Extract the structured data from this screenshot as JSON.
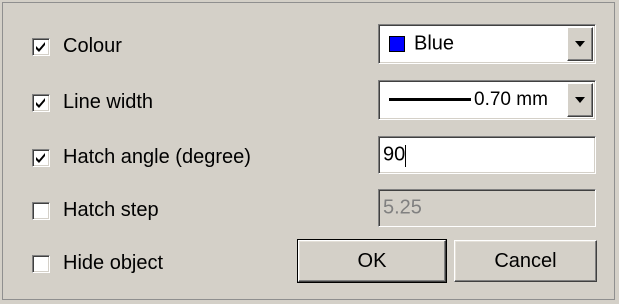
{
  "options": {
    "colour": {
      "label": "Colour",
      "checked": true
    },
    "line_width": {
      "label": "Line width",
      "checked": true
    },
    "hatch_angle": {
      "label": "Hatch angle (degree)",
      "checked": true
    },
    "hatch_step": {
      "label": "Hatch step",
      "checked": false
    },
    "hide_object": {
      "label": "Hide object",
      "checked": false
    }
  },
  "colour_select": {
    "value": "Blue",
    "swatch_color": "#0000ff"
  },
  "line_width_select": {
    "value": "0.70 mm"
  },
  "hatch_angle_input": {
    "value": "90"
  },
  "hatch_step_input": {
    "value": "5.25"
  },
  "buttons": {
    "ok": "OK",
    "cancel": "Cancel"
  }
}
